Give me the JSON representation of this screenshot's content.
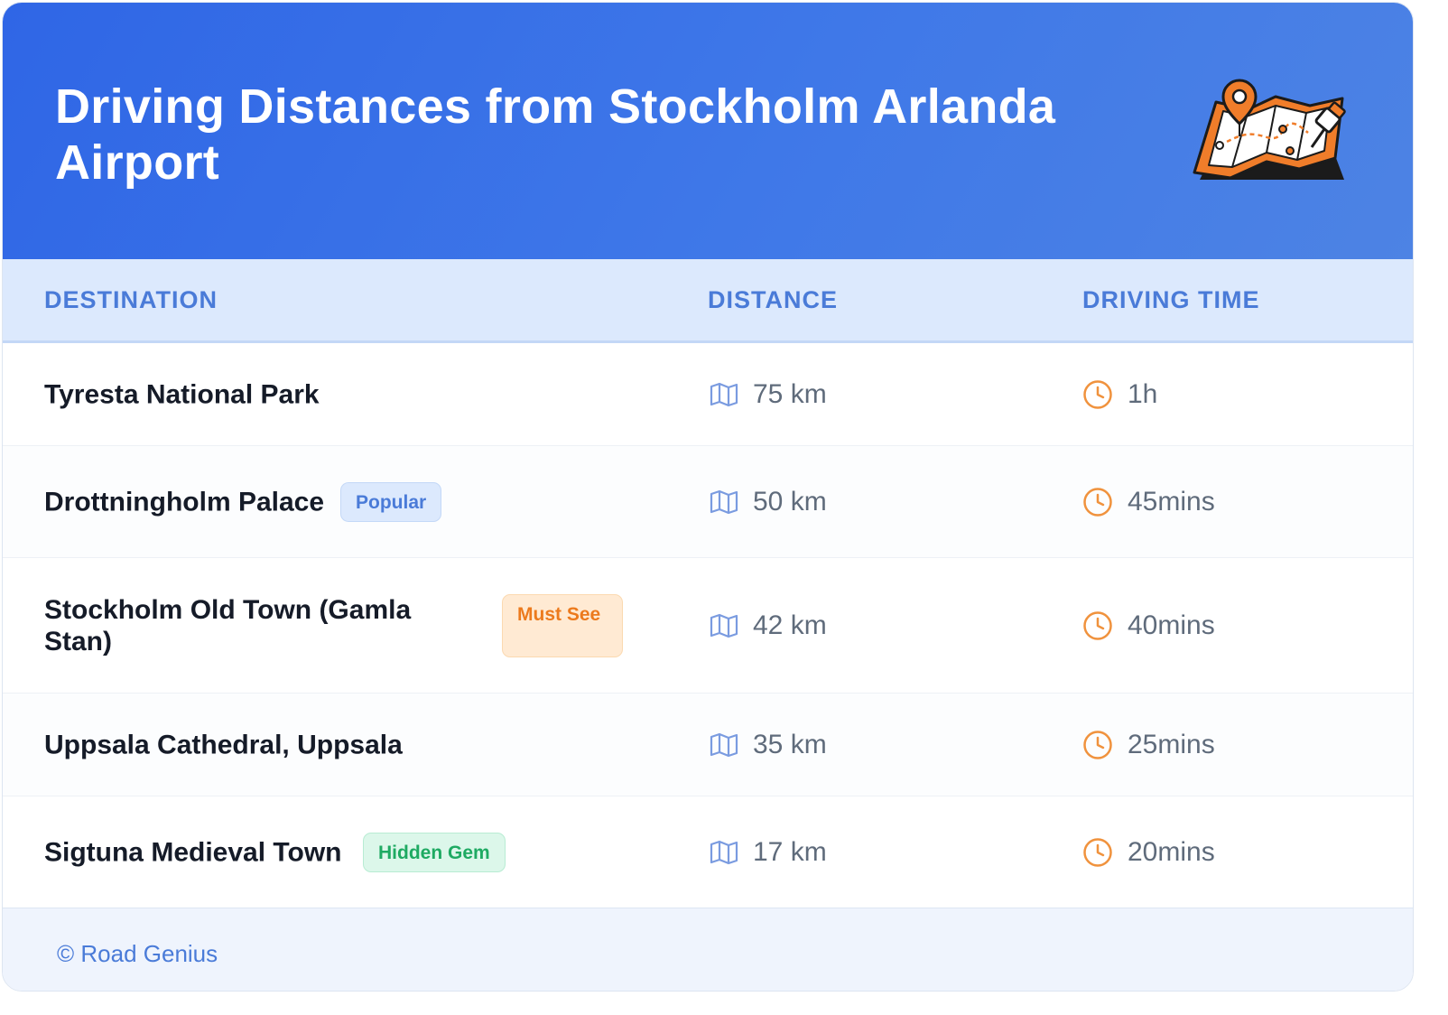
{
  "header": {
    "title": "Driving Distances from Stockholm Arlanda Airport",
    "illustration_icon": "map-with-pins-icon"
  },
  "columns": {
    "destination": "DESTINATION",
    "distance": "DISTANCE",
    "driving_time": "DRIVING TIME"
  },
  "rows": [
    {
      "destination": "Tyresta National Park",
      "badge": "",
      "distance": "75 km",
      "time": "1h"
    },
    {
      "destination": "Drottningholm Palace",
      "badge": "Popular",
      "distance": "50 km",
      "time": "45mins"
    },
    {
      "destination": "Stockholm Old Town (Gamla Stan)",
      "badge": "Must See",
      "distance": "42 km",
      "time": "40mins"
    },
    {
      "destination": "Uppsala Cathedral, Uppsala",
      "badge": "",
      "distance": "35 km",
      "time": "25mins"
    },
    {
      "destination": "Sigtuna Medieval Town",
      "badge": "Hidden Gem",
      "distance": "17 km",
      "time": "20mins"
    }
  ],
  "footer": {
    "credit": "© Road Genius"
  },
  "icons": {
    "distance": "map-icon",
    "time": "clock-icon"
  },
  "colors": {
    "header_gradient_start": "#2f66e6",
    "header_gradient_end": "#4d83e4",
    "accent_blue": "#4a7bd8",
    "accent_orange": "#ec7a1d",
    "accent_green": "#1eaa62"
  }
}
